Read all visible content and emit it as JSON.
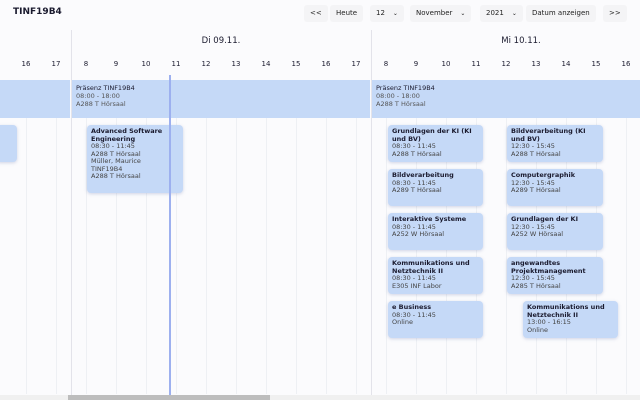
{
  "header": {
    "title": "TINF19B4",
    "prev": "<<",
    "today": "Heute",
    "day": "12",
    "month": "November",
    "year": "2021",
    "show_date": "Datum anzeigen",
    "next": ">>"
  },
  "days": [
    {
      "label": "Di 09.11."
    },
    {
      "label": "Mi 10.11."
    }
  ],
  "hours_prev": [
    "16",
    "17"
  ],
  "hours": [
    "8",
    "9",
    "10",
    "11",
    "12",
    "13",
    "14",
    "15",
    "16",
    "17"
  ],
  "hours_mi": [
    "8",
    "9",
    "10",
    "11",
    "12",
    "13",
    "14",
    "15",
    "16"
  ],
  "presence": [
    {
      "title": "Präsenz TINF19B4",
      "time": "08:00 - 18:00",
      "room": "A288 T Hörsaal"
    },
    {
      "title": "Präsenz TINF19B4",
      "time": "08:00 - 18:00",
      "room": "A288 T Hörsaal"
    }
  ],
  "events": [
    {
      "title": "Advanced Software Engineering",
      "time": "08:30 - 11:45",
      "lines": [
        "A288 T Hörsaal",
        "Müller, Maurice",
        "TINF19B4",
        "A288 T Hörsaal"
      ]
    },
    {
      "title": "Grundlagen der KI (KI und BV)",
      "time": "08:30 - 11:45",
      "lines": [
        "A288 T Hörsaal"
      ]
    },
    {
      "title": "Bildverarbeitung (KI und BV)",
      "time": "12:30 - 15:45",
      "lines": [
        "A288 T Hörsaal"
      ]
    },
    {
      "title": "Bildverarbeitung",
      "time": "08:30 - 11:45",
      "lines": [
        "A289 T Hörsaal"
      ]
    },
    {
      "title": "Computergraphik",
      "time": "12:30 - 15:45",
      "lines": [
        "A289 T Hörsaal"
      ]
    },
    {
      "title": "Interaktive Systeme",
      "time": "08:30 - 11:45",
      "lines": [
        "A252 W Hörsaal"
      ]
    },
    {
      "title": "Grundlagen der KI",
      "time": "12:30 - 15:45",
      "lines": [
        "A252 W Hörsaal"
      ]
    },
    {
      "title": "Kommunikations und Netztechnik II",
      "time": "08:30 - 11:45",
      "lines": [
        "E305 INF Labor"
      ]
    },
    {
      "title": "angewandtes Projektmanagement",
      "time": "12:30 - 15:45",
      "lines": [
        "A285 T Hörsaal"
      ]
    },
    {
      "title": "e Business",
      "time": "08:30 - 11:45",
      "lines": [
        "Online"
      ]
    },
    {
      "title": "Kommunikations und Netztechnik II",
      "time": "13:00 - 16:15",
      "lines": [
        "Online"
      ]
    }
  ]
}
